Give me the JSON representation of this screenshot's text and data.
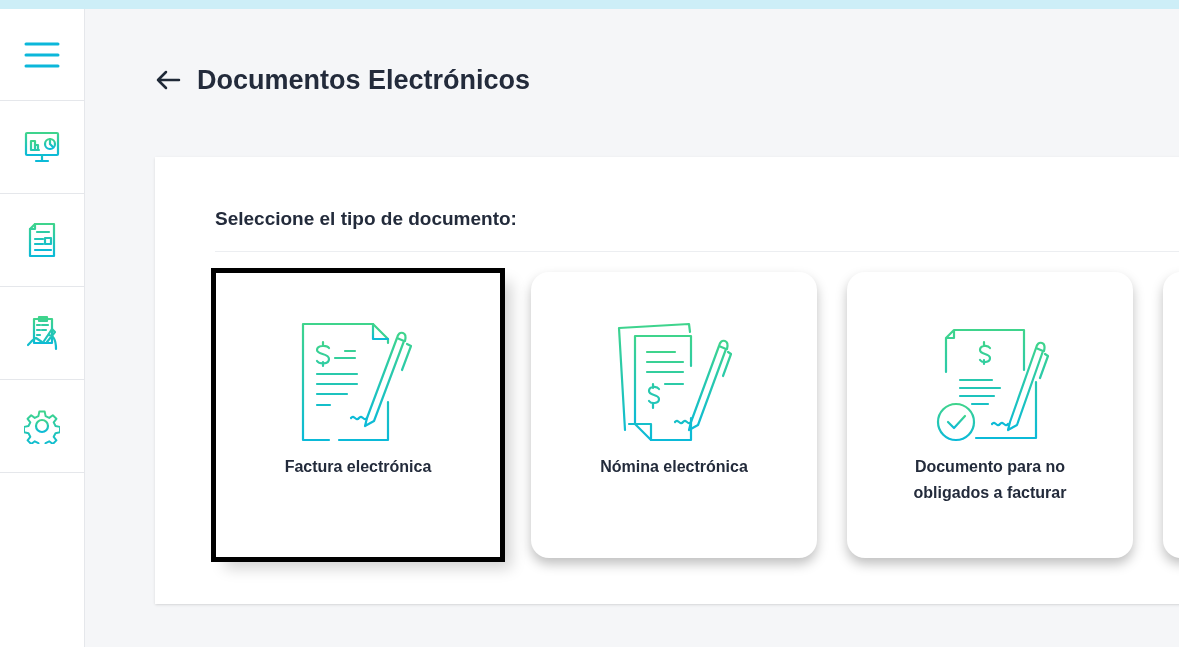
{
  "sidebar": {
    "items": [
      {
        "kind": "menu"
      },
      {
        "kind": "dashboard"
      },
      {
        "kind": "document"
      },
      {
        "kind": "checklist"
      },
      {
        "kind": "settings"
      }
    ]
  },
  "page": {
    "title": "Documentos Electrónicos"
  },
  "panel": {
    "heading": "Seleccione el tipo de documento:",
    "cards": [
      {
        "kind": "invoice",
        "label": "Factura electrónica",
        "selected": true
      },
      {
        "kind": "payroll",
        "label": "Nómina electrónica",
        "selected": false
      },
      {
        "kind": "support",
        "label": "Documento para no obligados a facturar",
        "selected": false
      },
      {
        "kind": "cut_off",
        "selected": false
      }
    ]
  }
}
